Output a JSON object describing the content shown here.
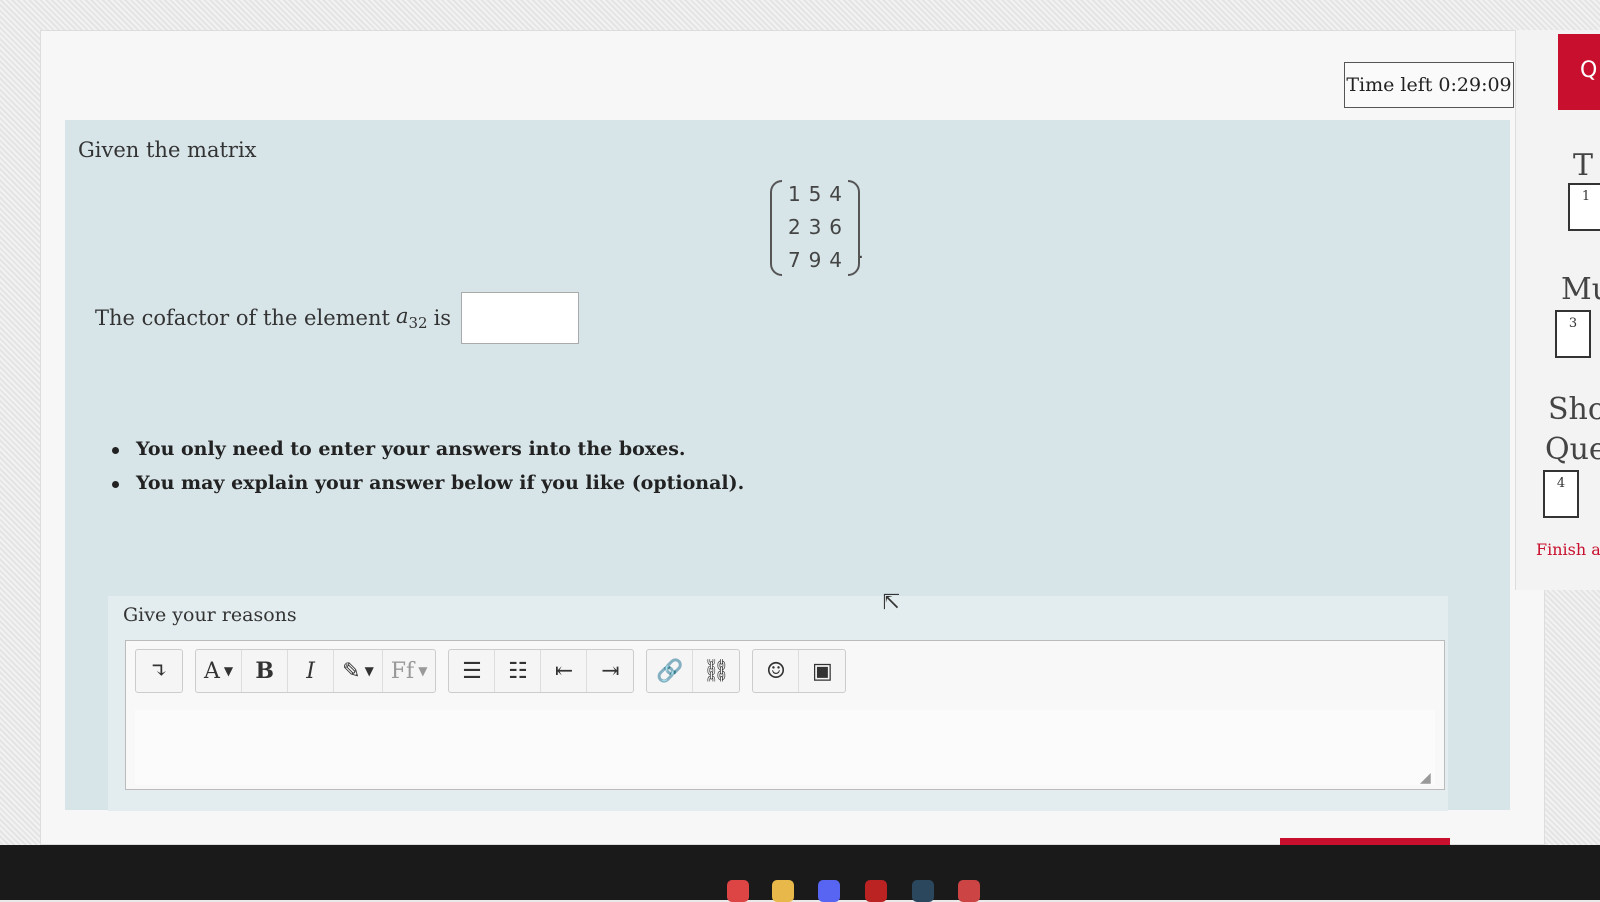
{
  "timer": {
    "text": "Time left 0:29:09"
  },
  "question": {
    "intro": "Given the matrix",
    "matrix": [
      [
        "1",
        "5",
        "4"
      ],
      [
        "2",
        "3",
        "6"
      ],
      [
        "7",
        "9",
        "4"
      ]
    ],
    "matrix_suffix": ".",
    "cofactor_prefix": "The cofactor of the element",
    "element_symbol": "a",
    "element_subscript": "32",
    "cofactor_suffix": "is",
    "answer_value": ""
  },
  "instructions": [
    "You only need to enter your answers into the boxes.",
    "You may explain your answer below if you like (optional)."
  ],
  "reasons": {
    "label": "Give your reasons",
    "toolbar": {
      "collapse": "↴",
      "font_size": "A",
      "bold": "B",
      "italic": "I",
      "brush": "✎",
      "font_family": "Ff",
      "caret": "▼",
      "unordered_list": "☰",
      "ordered_list": "☷",
      "outdent": "⇤",
      "indent": "⇥",
      "link": "🔗",
      "unlink": "⛓",
      "emoji": "☺",
      "image": "▣"
    },
    "text": ""
  },
  "sidebar": {
    "header": "Q",
    "items": [
      {
        "text": "T",
        "box": "1"
      },
      {
        "text": "Mu",
        "box": "3"
      },
      {
        "text": "Sho",
        "box": ""
      },
      {
        "text": "Que",
        "box": "4"
      }
    ],
    "finish": "Finish a"
  },
  "icons": {
    "cursor": "⇱"
  },
  "colors": {
    "accent": "#c8102e",
    "question_bg": "#d7e5e9"
  }
}
